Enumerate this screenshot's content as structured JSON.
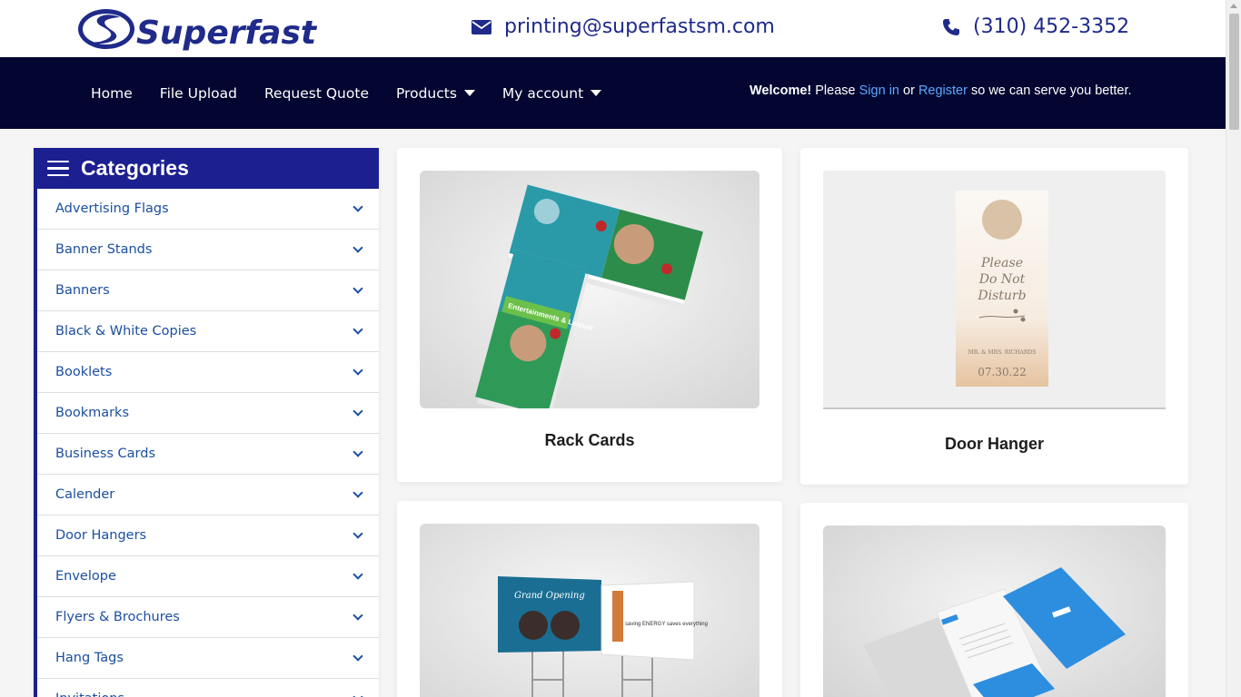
{
  "brand": {
    "name": "Superfast"
  },
  "contact": {
    "email": "printing@superfastsm.com",
    "phone": "(310) 452-3352"
  },
  "nav": {
    "items": [
      {
        "label": "Home",
        "dropdown": false
      },
      {
        "label": "File Upload",
        "dropdown": false
      },
      {
        "label": "Request Quote",
        "dropdown": false
      },
      {
        "label": "Products",
        "dropdown": true
      },
      {
        "label": "My account",
        "dropdown": true
      }
    ],
    "welcome": {
      "bold": "Welcome!",
      "please": "Please",
      "sign_in": "Sign in",
      "or": "or",
      "register": "Register",
      "tail": "so we can serve you better."
    }
  },
  "sidebar": {
    "title": "Categories",
    "items": [
      "Advertising Flags",
      "Banner Stands",
      "Banners",
      "Black & White Copies",
      "Booklets",
      "Bookmarks",
      "Business Cards",
      "Calender",
      "Door Hangers",
      "Envelope",
      "Flyers & Brochures",
      "Hang Tags",
      "Invitations"
    ]
  },
  "products": [
    {
      "title": "Rack Cards"
    },
    {
      "title": "Door Hanger"
    },
    {
      "title": ""
    },
    {
      "title": ""
    }
  ],
  "door_hanger_art": {
    "line1": "Please",
    "line2": "Do Not",
    "line3": "Disturb",
    "names": "MR. & MRS. RICHARDS",
    "date": "07.30.22"
  },
  "rack_card_art": {
    "headline": "Entertainments & Leisure"
  },
  "yard_sign_art": {
    "headline": "Grand Opening",
    "tagline": "saving ENERGY saves everything"
  },
  "colors": {
    "nav_bg": "#020631",
    "brand_blue": "#1b1f8f",
    "link_blue": "#5aa9ff"
  }
}
